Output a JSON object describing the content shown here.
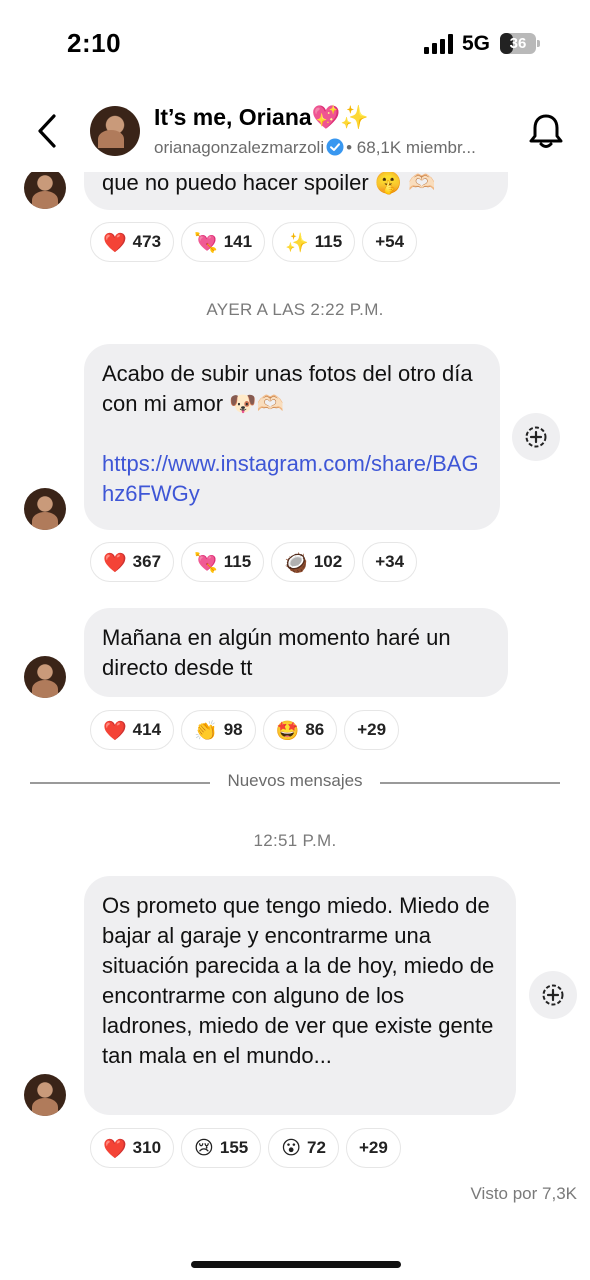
{
  "status_bar": {
    "time": "2:10",
    "network": "5G",
    "battery": "36",
    "battery_level": 0.36
  },
  "header": {
    "title": "It’s me, Oriana💖✨",
    "handle": "orianagonzalezmarzoli",
    "separator": "•",
    "members": "68,1K miembr..."
  },
  "messages": [
    {
      "text": "que no puedo hacer spoiler 🤫 🫶🏻",
      "reactions": [
        {
          "emoji": "❤️",
          "count": "473"
        },
        {
          "emoji": "💘",
          "count": "141"
        },
        {
          "emoji": "✨",
          "count": "115"
        },
        {
          "emoji": "",
          "count": "+54"
        }
      ]
    },
    {
      "timestamp": "AYER A LAS 2:22 P.M.",
      "text": "Acabo de subir unas fotos del otro día con mi amor 🐶🫶🏻",
      "link": "https://www.instagram.com/share/BAGhz6FWGy",
      "reactions": [
        {
          "emoji": "❤️",
          "count": "367"
        },
        {
          "emoji": "💘",
          "count": "115"
        },
        {
          "emoji": "🥥",
          "count": "102"
        },
        {
          "emoji": "",
          "count": "+34"
        }
      ]
    },
    {
      "text": "Mañana en algún momento haré un directo desde tt",
      "reactions": [
        {
          "emoji": "❤️",
          "count": "414"
        },
        {
          "emoji": "👏",
          "count": "98"
        },
        {
          "emoji": "🤩",
          "count": "86"
        },
        {
          "emoji": "",
          "count": "+29"
        }
      ]
    },
    {
      "timestamp": "12:51 P.M.",
      "text": "Os prometo que tengo miedo. Miedo de bajar al garaje y encontrarme una situación parecida a la de hoy, miedo de encontrarme con alguno de los ladrones, miedo de ver que existe gente tan mala en el mundo...",
      "reactions": [
        {
          "emoji": "❤️",
          "count": "310"
        },
        {
          "emoji": "😢",
          "count": "155"
        },
        {
          "emoji": "😮",
          "count": "72"
        },
        {
          "emoji": "",
          "count": "+29"
        }
      ]
    }
  ],
  "divider_label": "Nuevos mensajes",
  "seen_by": "Visto por 7,3K",
  "colors": {
    "link": "#3e56d6",
    "bubble": "#efeff1",
    "verified": "#3897f0"
  },
  "icons": [
    "back-icon",
    "bell-icon",
    "verified-icon",
    "share-icon",
    "signal-icon"
  ]
}
